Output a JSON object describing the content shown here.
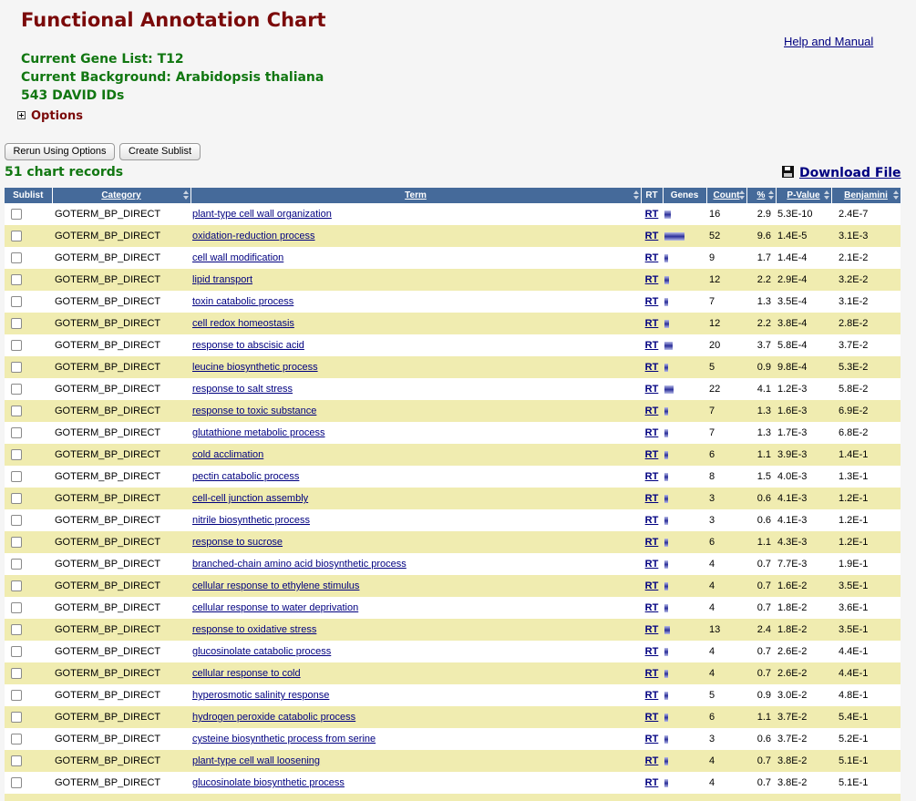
{
  "header": {
    "title": "Functional Annotation Chart",
    "help_link": "Help and Manual",
    "gene_list": "Current Gene List: T12",
    "background": "Current Background: Arabidopsis thaliana",
    "david_ids": "543 DAVID IDs",
    "options_label": "Options"
  },
  "toolbar": {
    "rerun_label": "Rerun Using Options",
    "create_sublist_label": "Create Sublist"
  },
  "records_label": "51 chart records",
  "download_label": "Download File",
  "table": {
    "columns": [
      "Sublist",
      "Category",
      "Term",
      "RT",
      "Genes",
      "Count",
      "%",
      "P-Value",
      "Benjamini"
    ],
    "rows": [
      {
        "category": "GOTERM_BP_DIRECT",
        "term": "plant-type cell wall organization",
        "rt": "RT",
        "count": "16",
        "pct": "2.9",
        "pvalue": "5.3E-10",
        "benjamini": "2.4E-7"
      },
      {
        "category": "GOTERM_BP_DIRECT",
        "term": "oxidation-reduction process",
        "rt": "RT",
        "count": "52",
        "pct": "9.6",
        "pvalue": "1.4E-5",
        "benjamini": "3.1E-3"
      },
      {
        "category": "GOTERM_BP_DIRECT",
        "term": "cell wall modification",
        "rt": "RT",
        "count": "9",
        "pct": "1.7",
        "pvalue": "1.4E-4",
        "benjamini": "2.1E-2"
      },
      {
        "category": "GOTERM_BP_DIRECT",
        "term": "lipid transport",
        "rt": "RT",
        "count": "12",
        "pct": "2.2",
        "pvalue": "2.9E-4",
        "benjamini": "3.2E-2"
      },
      {
        "category": "GOTERM_BP_DIRECT",
        "term": "toxin catabolic process",
        "rt": "RT",
        "count": "7",
        "pct": "1.3",
        "pvalue": "3.5E-4",
        "benjamini": "3.1E-2"
      },
      {
        "category": "GOTERM_BP_DIRECT",
        "term": "cell redox homeostasis",
        "rt": "RT",
        "count": "12",
        "pct": "2.2",
        "pvalue": "3.8E-4",
        "benjamini": "2.8E-2"
      },
      {
        "category": "GOTERM_BP_DIRECT",
        "term": "response to abscisic acid",
        "rt": "RT",
        "count": "20",
        "pct": "3.7",
        "pvalue": "5.8E-4",
        "benjamini": "3.7E-2"
      },
      {
        "category": "GOTERM_BP_DIRECT",
        "term": "leucine biosynthetic process",
        "rt": "RT",
        "count": "5",
        "pct": "0.9",
        "pvalue": "9.8E-4",
        "benjamini": "5.3E-2"
      },
      {
        "category": "GOTERM_BP_DIRECT",
        "term": "response to salt stress",
        "rt": "RT",
        "count": "22",
        "pct": "4.1",
        "pvalue": "1.2E-3",
        "benjamini": "5.8E-2"
      },
      {
        "category": "GOTERM_BP_DIRECT",
        "term": "response to toxic substance",
        "rt": "RT",
        "count": "7",
        "pct": "1.3",
        "pvalue": "1.6E-3",
        "benjamini": "6.9E-2"
      },
      {
        "category": "GOTERM_BP_DIRECT",
        "term": "glutathione metabolic process",
        "rt": "RT",
        "count": "7",
        "pct": "1.3",
        "pvalue": "1.7E-3",
        "benjamini": "6.8E-2"
      },
      {
        "category": "GOTERM_BP_DIRECT",
        "term": "cold acclimation",
        "rt": "RT",
        "count": "6",
        "pct": "1.1",
        "pvalue": "3.9E-3",
        "benjamini": "1.4E-1"
      },
      {
        "category": "GOTERM_BP_DIRECT",
        "term": "pectin catabolic process",
        "rt": "RT",
        "count": "8",
        "pct": "1.5",
        "pvalue": "4.0E-3",
        "benjamini": "1.3E-1"
      },
      {
        "category": "GOTERM_BP_DIRECT",
        "term": "cell-cell junction assembly",
        "rt": "RT",
        "count": "3",
        "pct": "0.6",
        "pvalue": "4.1E-3",
        "benjamini": "1.2E-1"
      },
      {
        "category": "GOTERM_BP_DIRECT",
        "term": "nitrile biosynthetic process",
        "rt": "RT",
        "count": "3",
        "pct": "0.6",
        "pvalue": "4.1E-3",
        "benjamini": "1.2E-1"
      },
      {
        "category": "GOTERM_BP_DIRECT",
        "term": "response to sucrose",
        "rt": "RT",
        "count": "6",
        "pct": "1.1",
        "pvalue": "4.3E-3",
        "benjamini": "1.2E-1"
      },
      {
        "category": "GOTERM_BP_DIRECT",
        "term": "branched-chain amino acid biosynthetic process",
        "rt": "RT",
        "count": "4",
        "pct": "0.7",
        "pvalue": "7.7E-3",
        "benjamini": "1.9E-1"
      },
      {
        "category": "GOTERM_BP_DIRECT",
        "term": "cellular response to ethylene stimulus",
        "rt": "RT",
        "count": "4",
        "pct": "0.7",
        "pvalue": "1.6E-2",
        "benjamini": "3.5E-1"
      },
      {
        "category": "GOTERM_BP_DIRECT",
        "term": "cellular response to water deprivation",
        "rt": "RT",
        "count": "4",
        "pct": "0.7",
        "pvalue": "1.8E-2",
        "benjamini": "3.6E-1"
      },
      {
        "category": "GOTERM_BP_DIRECT",
        "term": "response to oxidative stress",
        "rt": "RT",
        "count": "13",
        "pct": "2.4",
        "pvalue": "1.8E-2",
        "benjamini": "3.5E-1"
      },
      {
        "category": "GOTERM_BP_DIRECT",
        "term": "glucosinolate catabolic process",
        "rt": "RT",
        "count": "4",
        "pct": "0.7",
        "pvalue": "2.6E-2",
        "benjamini": "4.4E-1"
      },
      {
        "category": "GOTERM_BP_DIRECT",
        "term": "cellular response to cold",
        "rt": "RT",
        "count": "4",
        "pct": "0.7",
        "pvalue": "2.6E-2",
        "benjamini": "4.4E-1"
      },
      {
        "category": "GOTERM_BP_DIRECT",
        "term": "hyperosmotic salinity response",
        "rt": "RT",
        "count": "5",
        "pct": "0.9",
        "pvalue": "3.0E-2",
        "benjamini": "4.8E-1"
      },
      {
        "category": "GOTERM_BP_DIRECT",
        "term": "hydrogen peroxide catabolic process",
        "rt": "RT",
        "count": "6",
        "pct": "1.1",
        "pvalue": "3.7E-2",
        "benjamini": "5.4E-1"
      },
      {
        "category": "GOTERM_BP_DIRECT",
        "term": "cysteine biosynthetic process from serine",
        "rt": "RT",
        "count": "3",
        "pct": "0.6",
        "pvalue": "3.7E-2",
        "benjamini": "5.2E-1"
      },
      {
        "category": "GOTERM_BP_DIRECT",
        "term": "plant-type cell wall loosening",
        "rt": "RT",
        "count": "4",
        "pct": "0.7",
        "pvalue": "3.8E-2",
        "benjamini": "5.1E-1"
      },
      {
        "category": "GOTERM_BP_DIRECT",
        "term": "glucosinolate biosynthetic process",
        "rt": "RT",
        "count": "4",
        "pct": "0.7",
        "pvalue": "3.8E-2",
        "benjamini": "5.1E-1"
      }
    ]
  },
  "colors": {
    "title": "#7b0a0a",
    "info_green": "#117711",
    "header_bg": "#456a9a",
    "row_alt": "#f0ecb0",
    "link": "#000080"
  }
}
